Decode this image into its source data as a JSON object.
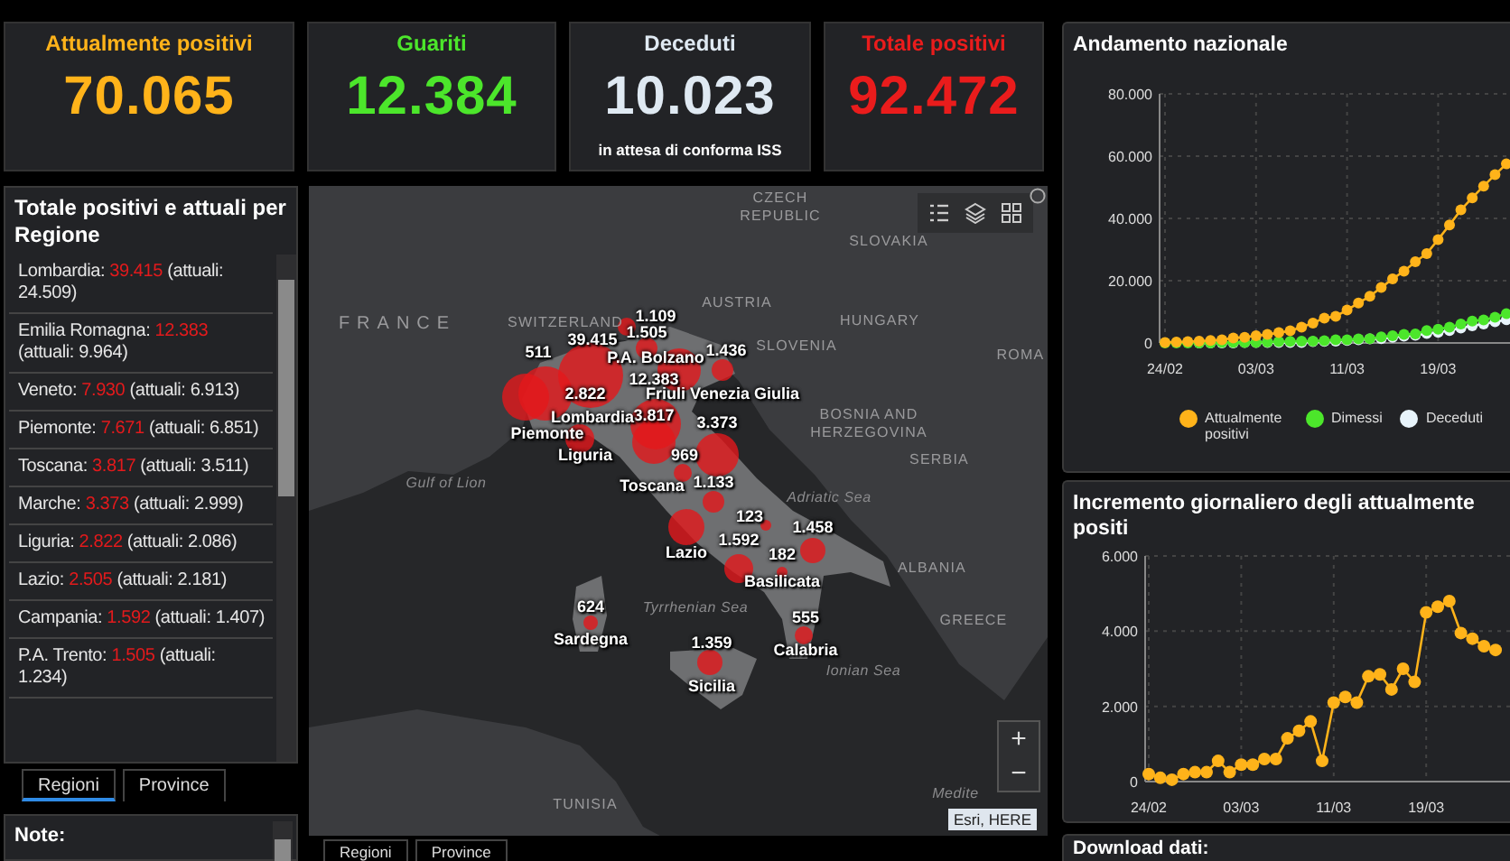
{
  "cards": [
    {
      "label": "Attualmente positivi",
      "value": "70.065",
      "color": "#ffb31a"
    },
    {
      "label": "Guariti",
      "value": "12.384",
      "color": "#4ce62b"
    },
    {
      "label": "Deceduti",
      "value": "10.023",
      "note": "in attesa di conforma ISS",
      "color": "#dfe9f2"
    },
    {
      "label": "Totale positivi",
      "value": "92.472",
      "color": "#ea1c1c"
    }
  ],
  "regions_panel": {
    "title": "Totale positivi e attuali per Regione",
    "items": [
      {
        "region": "Lombardia:",
        "total": "39.415",
        "current": "(attuali: 24.509)"
      },
      {
        "region": "Emilia Romagna:",
        "total": "12.383",
        "current": "(attuali: 9.964)"
      },
      {
        "region": "Veneto:",
        "total": "7.930",
        "current": "(attuali: 6.913)"
      },
      {
        "region": "Piemonte:",
        "total": "7.671",
        "current": "(attuali: 6.851)"
      },
      {
        "region": "Toscana:",
        "total": "3.817",
        "current": "(attuali: 3.511)"
      },
      {
        "region": "Marche:",
        "total": "3.373",
        "current": "(attuali: 2.999)"
      },
      {
        "region": "Liguria:",
        "total": "2.822",
        "current": "(attuali: 2.086)"
      },
      {
        "region": "Lazio:",
        "total": "2.505",
        "current": "(attuali: 2.181)"
      },
      {
        "region": "Campania:",
        "total": "1.592",
        "current": "(attuali: 1.407)"
      },
      {
        "region": "P.A. Trento:",
        "total": "1.505",
        "current": "(attuali: 1.234)"
      }
    ]
  },
  "left_tabs": [
    {
      "label": "Regioni",
      "selected": true
    },
    {
      "label": "Province",
      "selected": false
    }
  ],
  "note_panel": {
    "title": "Note:"
  },
  "map": {
    "place_labels": [
      "CZECH REPUBLIC",
      "SLOVAKIA",
      "AUSTRIA",
      "FRANCE",
      "SWITZERLAND",
      "HUNGARY",
      "SLOVENIA",
      "ROMA",
      "BOSNIA AND HERZEGOVINA",
      "SERBIA",
      "Gulf of Lion",
      "Adriatic Sea",
      "Tyrrhenian Sea",
      "ALBANIA",
      "GREECE",
      "Ionian Sea",
      "TUNISIA",
      "Medite"
    ],
    "value_labels": [
      "511",
      "39.415",
      "1.109",
      "1.505",
      "1.436",
      "12.383",
      "2.822",
      "3.817",
      "3.373",
      "969",
      "1.133",
      "123",
      "1.458",
      "1.592",
      "182",
      "624",
      "555",
      "1.359"
    ],
    "region_labels": [
      "P.A. Bolzano",
      "Friuli Venezia Giulia",
      "Lombardia",
      "Piemonte",
      "Liguria",
      "Toscana",
      "Lazio",
      "Basilicata",
      "Sardegna",
      "Calabria",
      "Sicilia"
    ],
    "zoom_in": "+",
    "zoom_out": "−",
    "attribution": "Esri, HERE"
  },
  "map_tabs": [
    {
      "label": "Regioni",
      "selected": false
    },
    {
      "label": "Province",
      "selected": false
    }
  ],
  "national_chart": {
    "title": "Andamento nazionale",
    "chart_data": {
      "type": "line",
      "grid": true,
      "categories": [
        "24/02",
        null,
        null,
        null,
        null,
        null,
        null,
        null,
        "03/03",
        null,
        null,
        null,
        null,
        null,
        null,
        null,
        "11/03",
        null,
        null,
        null,
        null,
        null,
        null,
        null,
        "19/03",
        null,
        null,
        null,
        null,
        null,
        null
      ],
      "series": [
        {
          "name": "Attualmente positivi",
          "color": "#ffb31a",
          "marker": true,
          "values": [
            200,
            300,
            400,
            600,
            800,
            1000,
            1600,
            1800,
            2300,
            2700,
            3300,
            3900,
            5100,
            6400,
            8000,
            8500,
            10600,
            12800,
            15000,
            17800,
            20600,
            23100,
            26100,
            28700,
            33200,
            37900,
            42700,
            46600,
            50400,
            54000,
            57500
          ]
        },
        {
          "name": "Dimessi",
          "color": "#4ce62b",
          "marker": true,
          "values": [
            0,
            0,
            0,
            0,
            0,
            100,
            100,
            100,
            200,
            300,
            400,
            500,
            600,
            600,
            700,
            1000,
            1000,
            1300,
            1400,
            2000,
            2300,
            2700,
            2900,
            4000,
            4400,
            5100,
            6100,
            7000,
            7400,
            8300,
            9400
          ]
        },
        {
          "name": "Deceduti",
          "color": "#e8f4fb",
          "marker": true,
          "values": [
            null,
            null,
            null,
            0,
            0,
            0,
            0,
            100,
            100,
            100,
            100,
            200,
            200,
            400,
            500,
            600,
            800,
            1000,
            1300,
            1400,
            1800,
            2200,
            2500,
            3000,
            3400,
            4000,
            4800,
            5500,
            6100,
            6800,
            7500
          ]
        }
      ],
      "ylim": [
        0,
        80000
      ],
      "yticks": [
        {
          "value": 0,
          "label": "0"
        },
        {
          "value": 20000,
          "label": "20.000"
        },
        {
          "value": 40000,
          "label": "40.000"
        },
        {
          "value": 60000,
          "label": "60.000"
        },
        {
          "value": 80000,
          "label": "80.000"
        }
      ]
    }
  },
  "daily_chart": {
    "title": "Incremento giornaliero degli attualmente positi",
    "chart_data": {
      "type": "line",
      "grid": true,
      "categories": [
        "24/02",
        null,
        null,
        null,
        null,
        null,
        null,
        null,
        "03/03",
        null,
        null,
        null,
        null,
        null,
        null,
        null,
        "11/03",
        null,
        null,
        null,
        null,
        null,
        null,
        null,
        "19/03",
        null,
        null,
        null,
        null,
        null,
        null
      ],
      "series": [
        {
          "color": "#ffb31a",
          "marker": true,
          "values": [
            200,
            100,
            50,
            200,
            250,
            250,
            550,
            250,
            450,
            450,
            600,
            600,
            1150,
            1350,
            1600,
            550,
            2100,
            2250,
            2100,
            2800,
            2850,
            2450,
            3000,
            2650,
            4500,
            4650,
            4800,
            3950,
            3800,
            3600,
            3500
          ]
        }
      ],
      "ylim": [
        0,
        6000
      ],
      "yticks": [
        {
          "value": 0,
          "label": "0"
        },
        {
          "value": 2000,
          "label": "2.000"
        },
        {
          "value": 4000,
          "label": "4.000"
        },
        {
          "value": 6000,
          "label": "6.000"
        }
      ]
    }
  },
  "download_panel": {
    "title": "Download dati:"
  }
}
